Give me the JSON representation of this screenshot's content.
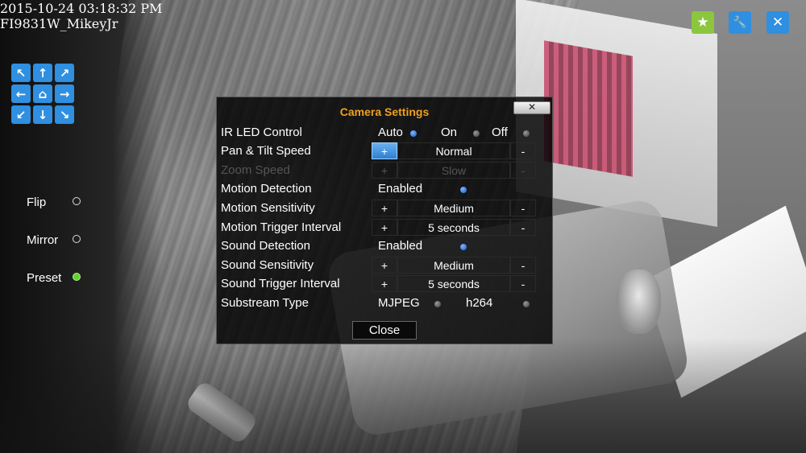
{
  "osd": {
    "timestamp": "2015-10-24 03:18:32 PM",
    "camera_name": "FI9831W_MikeyJr"
  },
  "top_buttons": {
    "favorite_glyph": "★",
    "settings_glyph": "🔧",
    "close_glyph": "✕"
  },
  "ptz": {
    "up_left": "↖",
    "up": "↑",
    "up_right": "↗",
    "left": "←",
    "home": "⌂",
    "right": "→",
    "down_left": "↙",
    "down": "↓",
    "down_right": "↘"
  },
  "side": {
    "flip_label": "Flip",
    "mirror_label": "Mirror",
    "preset_label": "Preset"
  },
  "dialog": {
    "title": "Camera Settings",
    "close_x": "✕",
    "close_label": "Close",
    "ir_led": {
      "label": "IR LED Control",
      "auto": "Auto",
      "on": "On",
      "off": "Off",
      "selected": "Auto"
    },
    "pan_tilt": {
      "label": "Pan & Tilt Speed",
      "plus": "+",
      "value": "Normal",
      "minus": "-"
    },
    "zoom": {
      "label": "Zoom Speed",
      "plus": "+",
      "value": "Slow",
      "minus": "-"
    },
    "motion_detection": {
      "label": "Motion Detection",
      "value": "Enabled"
    },
    "motion_sensitivity": {
      "label": "Motion Sensitivity",
      "plus": "+",
      "value": "Medium",
      "minus": "-"
    },
    "motion_trigger": {
      "label": "Motion Trigger Interval",
      "plus": "+",
      "value": "5 seconds",
      "minus": "-"
    },
    "sound_detection": {
      "label": "Sound Detection",
      "value": "Enabled"
    },
    "sound_sensitivity": {
      "label": "Sound Sensitivity",
      "plus": "+",
      "value": "Medium",
      "minus": "-"
    },
    "sound_trigger": {
      "label": "Sound Trigger Interval",
      "plus": "+",
      "value": "5 seconds",
      "minus": "-"
    },
    "substream": {
      "label": "Substream Type",
      "mjpeg": "MJPEG",
      "h264": "h264"
    }
  },
  "colors": {
    "accent_blue": "#2f8fe0",
    "accent_green": "#8cc63f",
    "title_orange": "#f0a020"
  }
}
